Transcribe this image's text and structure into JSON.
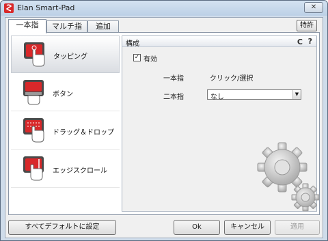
{
  "window": {
    "title": "Elan Smart-Pad",
    "close_label": "✕"
  },
  "tabs": [
    {
      "label": "一本指",
      "active": true
    },
    {
      "label": "マルチ指",
      "active": false
    },
    {
      "label": "追加",
      "active": false
    }
  ],
  "patent_button": "特許",
  "sidebar": {
    "items": [
      {
        "label": "タッピング",
        "icon": "tapping-icon",
        "selected": true
      },
      {
        "label": "ボタン",
        "icon": "button-icon",
        "selected": false
      },
      {
        "label": "ドラッグ＆ドロップ",
        "icon": "drag-drop-icon",
        "selected": false
      },
      {
        "label": "エッジスクロール",
        "icon": "edge-scroll-icon",
        "selected": false
      }
    ]
  },
  "content": {
    "title": "構成",
    "refresh_glyph": "C",
    "help_glyph": "?",
    "enabled": {
      "label": "有効",
      "checked": true,
      "check_glyph": "✓"
    },
    "rows": [
      {
        "label": "一本指",
        "value": "クリック/選択"
      },
      {
        "label": "二本指",
        "value": "なし"
      }
    ],
    "select_arrow": "▼"
  },
  "buttons": {
    "defaults": "すべてデフォルトに設定",
    "ok": "Ok",
    "cancel": "キャンセル",
    "apply": "適用"
  },
  "colors": {
    "accent_red": "#d8282a",
    "window_frame": "#cfdcea"
  }
}
